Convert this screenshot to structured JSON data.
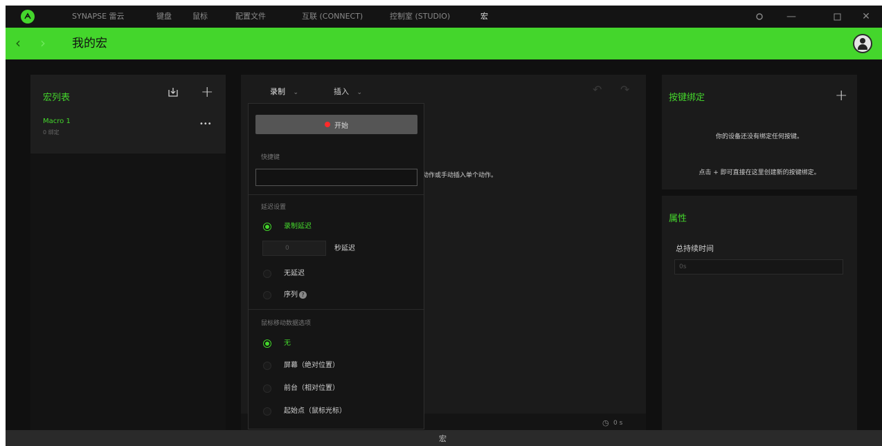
{
  "titlebar": {
    "nav": [
      {
        "label": "SYNAPSE 雷云"
      },
      {
        "label": "键盘"
      },
      {
        "label": "鼠标"
      },
      {
        "label": "配置文件"
      },
      {
        "label": "互联 (CONNECT)"
      },
      {
        "label": "控制室 (STUDIO)"
      },
      {
        "label": "宏"
      }
    ]
  },
  "header": {
    "title": "我的宏"
  },
  "macro_list": {
    "title": "宏列表",
    "items": [
      {
        "name": "Macro 1",
        "sub": "0 绑定",
        "more": "•••"
      }
    ]
  },
  "editor": {
    "record_tab": "录制",
    "insert_tab": "插入",
    "hint_text": "动作或手动插入单个动作。",
    "duration": "0 s"
  },
  "record_menu": {
    "start_label": "开始",
    "hotkey_label": "快捷键",
    "delay_section": "延迟设置",
    "delay_options": [
      "录制延迟",
      "秒延迟",
      "无延迟",
      "序列"
    ],
    "delay_value": "0",
    "mouse_section": "鼠标移动数据选项",
    "mouse_options": [
      "无",
      "屏幕（绝对位置）",
      "前台（相对位置）",
      "起始点（鼠标光标）"
    ]
  },
  "key_binding": {
    "title": "按键绑定",
    "empty_line1": "你的设备还没有绑定任何按键。",
    "empty_line2": "点击 + 即可直接在这里创建新的按键绑定。"
  },
  "properties": {
    "title": "属性",
    "duration_label": "总持续时间",
    "duration_value": "0s"
  },
  "status_bar": {
    "label": "宏"
  },
  "colors": {
    "accent": "#44d62c",
    "record": "#ff2a2a"
  }
}
